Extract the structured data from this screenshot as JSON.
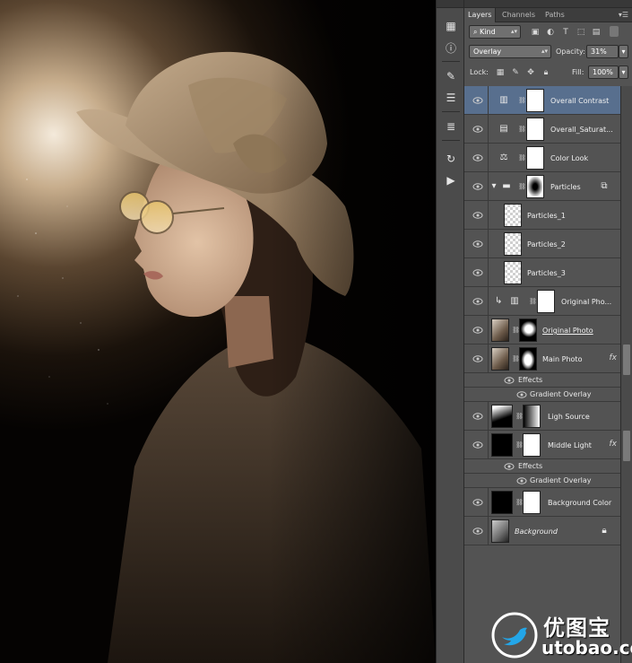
{
  "panel": {
    "tabs": [
      "Layers",
      "Channels",
      "Paths"
    ],
    "active_tab": "Layers",
    "kind_filter": "Kind",
    "blend_mode": "Overlay",
    "opacity_label": "Opacity:",
    "opacity_value": "31%",
    "lock_label": "Lock:",
    "fill_label": "Fill:",
    "fill_value": "100%"
  },
  "layers": [
    {
      "name": "Overall Contrast",
      "selected": true
    },
    {
      "name": "Overall_Saturat..."
    },
    {
      "name": "Color Look"
    },
    {
      "name": "Particles"
    },
    {
      "name": "Particles_1"
    },
    {
      "name": "Particles_2"
    },
    {
      "name": "Particles_3"
    },
    {
      "name": "Original Pho..."
    },
    {
      "name": "Original Photo"
    },
    {
      "name": "Main Photo",
      "fx": "fx",
      "effects_label": "Effects",
      "effect": "Gradient Overlay"
    },
    {
      "name": "Ligh Source"
    },
    {
      "name": "Middle Light",
      "fx": "fx",
      "effects_label": "Effects",
      "effect": "Gradient Overlay"
    },
    {
      "name": "Background Color"
    },
    {
      "name": "Background"
    }
  ],
  "watermark": {
    "cn": "优图宝",
    "en": "utobao.com"
  },
  "colors": {
    "panel_bg": "#535353",
    "selected_row": "#586f8e",
    "toolbar_bg": "#4b4b4b"
  }
}
